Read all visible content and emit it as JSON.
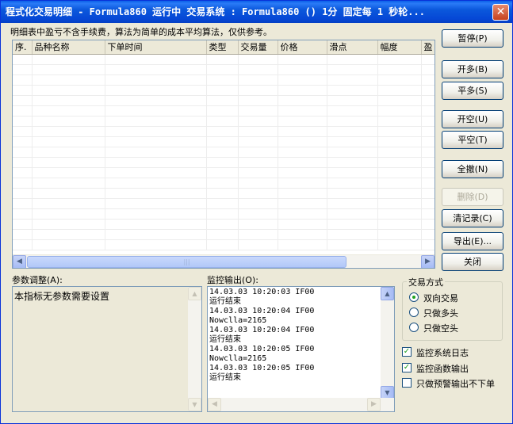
{
  "window": {
    "title": "程式化交易明细 - Formula860 运行中  交易系统 : Formula860 () 1分 固定每 1 秒轮...",
    "close_label": "✕"
  },
  "info_text": "明细表中盈亏不含手续费，算法为简单的成本平均算法，仅供参考。",
  "grid": {
    "columns": [
      "序.",
      "品种名称",
      "下单时间",
      "类型",
      "交易量",
      "价格",
      "滑点",
      "幅度",
      "盈"
    ],
    "rows": []
  },
  "buttons": {
    "pause": "暂停(P)",
    "open_long": "开多(B)",
    "close_long": "平多(S)",
    "open_short": "开空(U)",
    "close_short": "平空(T)",
    "cancel_all": "全撤(N)",
    "delete": "删除(D)",
    "clear_log": "清记录(C)",
    "export": "导出(E)...",
    "close": "关闭"
  },
  "params": {
    "label": "参数调整(A):",
    "text": "本指标无参数需要设置"
  },
  "monitor": {
    "label": "监控输出(O):",
    "lines": [
      "14.03.03 10:20:03 IF00",
      "运行结束",
      "14.03.03 10:20:04 IF00",
      "Nowclla=2165",
      "14.03.03 10:20:04 IF00",
      "运行结束",
      "14.03.03 10:20:05 IF00",
      "Nowclla=2165",
      "14.03.03 10:20:05 IF00",
      "运行结束"
    ]
  },
  "trade_mode": {
    "label": "交易方式",
    "options": [
      "双向交易",
      "只做多头",
      "只做空头"
    ],
    "selected": "双向交易"
  },
  "checkboxes": [
    {
      "label": "监控系统日志",
      "checked": true
    },
    {
      "label": "监控函数输出",
      "checked": true
    },
    {
      "label": "只做预警输出不下单",
      "checked": false
    }
  ]
}
